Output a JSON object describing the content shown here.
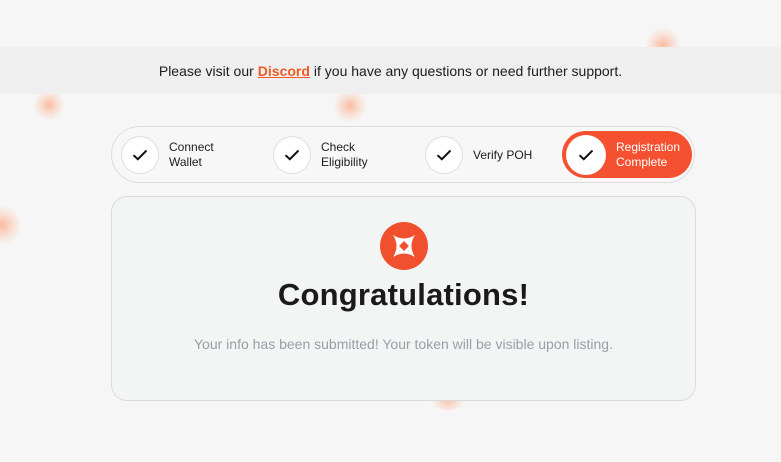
{
  "banner": {
    "text_before": "Please visit our",
    "link_label": "Discord",
    "text_after": "if you have any questions or need further support."
  },
  "steps": [
    {
      "label": "Connect\nWallet",
      "icon": "check-icon",
      "state": "done"
    },
    {
      "label": "Check\nEligibility",
      "icon": "check-icon",
      "state": "done"
    },
    {
      "label": "Verify POH",
      "icon": "check-icon",
      "state": "done"
    },
    {
      "label": "Registration\nComplete",
      "icon": "check-icon",
      "state": "active"
    }
  ],
  "card": {
    "logo_icon": "brand-logo-icon",
    "title": "Congratulations!",
    "message": "Your info has been submitted! Your token will be visible upon listing."
  },
  "colors": {
    "accent": "#f5502f",
    "link": "#f15a24",
    "muted_text": "#9a9da6"
  }
}
